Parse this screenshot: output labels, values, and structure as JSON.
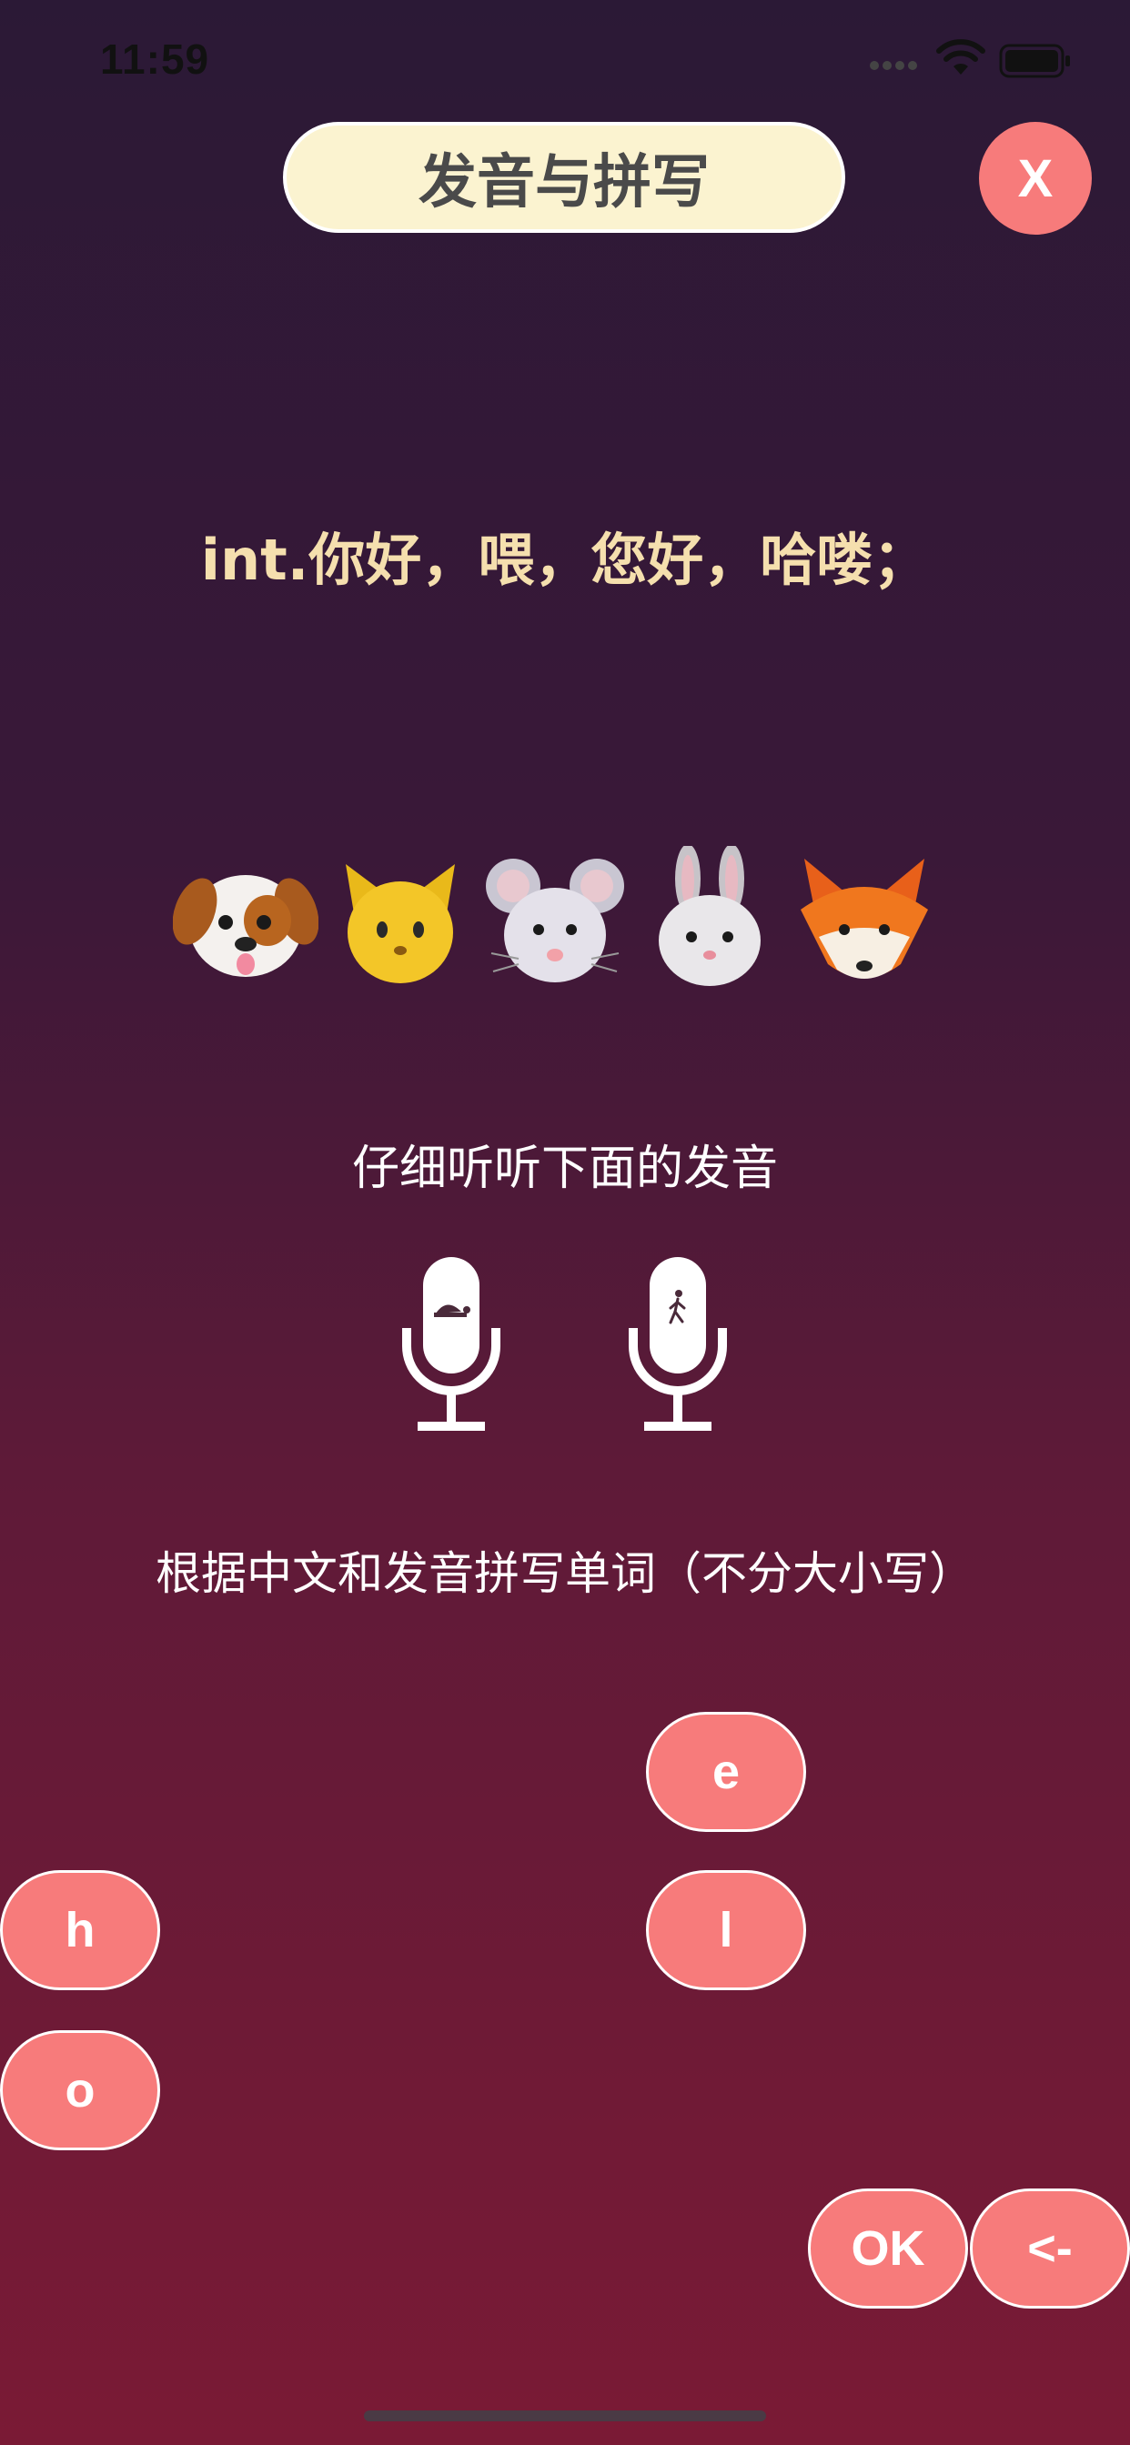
{
  "status_bar": {
    "time": "11:59"
  },
  "header": {
    "title": "发音与拼写",
    "close_label": "X"
  },
  "word": {
    "meaning": "int.你好，喂，您好，哈喽；"
  },
  "listen_hint": "仔细听听下面的发音",
  "instruction": "根据中文和发音拼写单词（不分大小写）",
  "audio_buttons": [
    {
      "name": "slow",
      "icon": "turtle-icon"
    },
    {
      "name": "normal",
      "icon": "walking-person-icon"
    }
  ],
  "letters": [
    "e",
    "h",
    "l",
    "o"
  ],
  "actions": {
    "ok_label": "OK",
    "backspace_label": "<-"
  },
  "colors": {
    "accent": "#f77b7b",
    "title_bg": "#fbf3d0",
    "meaning_text": "#f5dfae"
  }
}
